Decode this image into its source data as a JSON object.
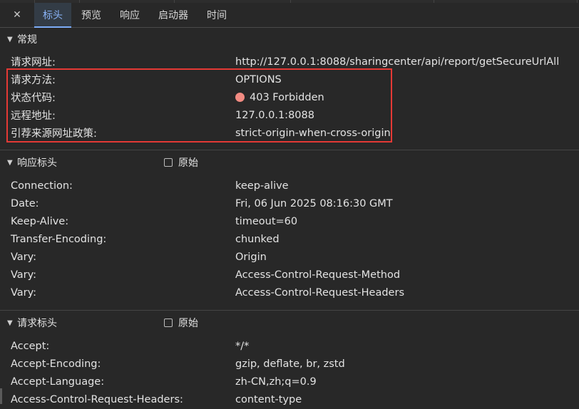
{
  "tabs": {
    "close_label": "✕",
    "items": [
      {
        "label": "标头",
        "active": true
      },
      {
        "label": "预览",
        "active": false
      },
      {
        "label": "响应",
        "active": false
      },
      {
        "label": "启动器",
        "active": false
      },
      {
        "label": "时间",
        "active": false
      }
    ]
  },
  "general": {
    "title": "常规",
    "rows": [
      {
        "key": "请求网址:",
        "value": "http://127.0.0.1:8088/sharingcenter/api/report/getSecureUrlAll"
      },
      {
        "key": "请求方法:",
        "value": "OPTIONS"
      },
      {
        "key": "状态代码:",
        "value": "403 Forbidden"
      },
      {
        "key": "远程地址:",
        "value": "127.0.0.1:8088"
      },
      {
        "key": "引荐来源网址政策:",
        "value": "strict-origin-when-cross-origin"
      }
    ]
  },
  "response_headers": {
    "title": "响应标头",
    "raw_label": "原始",
    "rows": [
      {
        "key": "Connection:",
        "value": "keep-alive"
      },
      {
        "key": "Date:",
        "value": "Fri, 06 Jun 2025 08:16:30 GMT"
      },
      {
        "key": "Keep-Alive:",
        "value": "timeout=60"
      },
      {
        "key": "Transfer-Encoding:",
        "value": "chunked"
      },
      {
        "key": "Vary:",
        "value": "Origin"
      },
      {
        "key": "Vary:",
        "value": "Access-Control-Request-Method"
      },
      {
        "key": "Vary:",
        "value": "Access-Control-Request-Headers"
      }
    ]
  },
  "request_headers": {
    "title": "请求标头",
    "raw_label": "原始",
    "rows": [
      {
        "key": "Accept:",
        "value": "*/*"
      },
      {
        "key": "Accept-Encoding:",
        "value": "gzip, deflate, br, zstd"
      },
      {
        "key": "Accept-Language:",
        "value": "zh-CN,zh;q=0.9"
      },
      {
        "key": "Access-Control-Request-Headers:",
        "value": "content-type"
      }
    ]
  },
  "colors": {
    "status_dot": "#f28b82",
    "highlight_border": "#e53935",
    "active_tab": "#8ab4f8"
  },
  "icons": {
    "close": "close-icon",
    "section_toggle": "triangle-down-icon",
    "status": "status-error-dot-icon"
  }
}
